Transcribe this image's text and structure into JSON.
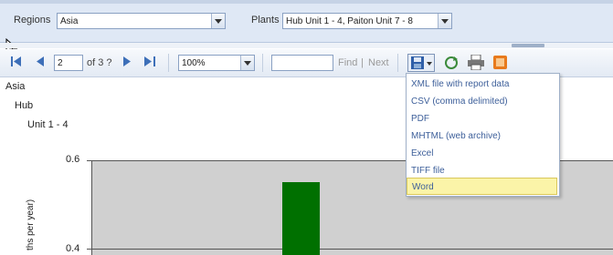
{
  "params": {
    "regions_label": "Regions",
    "regions_value": "Asia",
    "plants_label": "Plants",
    "plants_value": "Hub Unit 1 - 4, Paiton Unit 7 - 8"
  },
  "toolbar": {
    "page_current": "2",
    "page_of": "of 3 ?",
    "zoom": "100%",
    "find_value": "",
    "find_label": "Find",
    "divider": "|",
    "next_label": "Next"
  },
  "export_menu": {
    "items": [
      "XML file with report data",
      "CSV (comma delimited)",
      "PDF",
      "MHTML (web archive)",
      "Excel",
      "TIFF file",
      "Word"
    ],
    "highlighted": "Word"
  },
  "report": {
    "group1": "Asia",
    "group2": "Hub",
    "group3": "Unit 1 - 4"
  },
  "chart_data": {
    "type": "bar",
    "ylabel_partial": "ths per year)",
    "y_ticks": [
      "0.6",
      "0.4"
    ],
    "values": [
      0.55
    ],
    "bar_color": "#007000",
    "plot_background": "#d0d0d0"
  }
}
